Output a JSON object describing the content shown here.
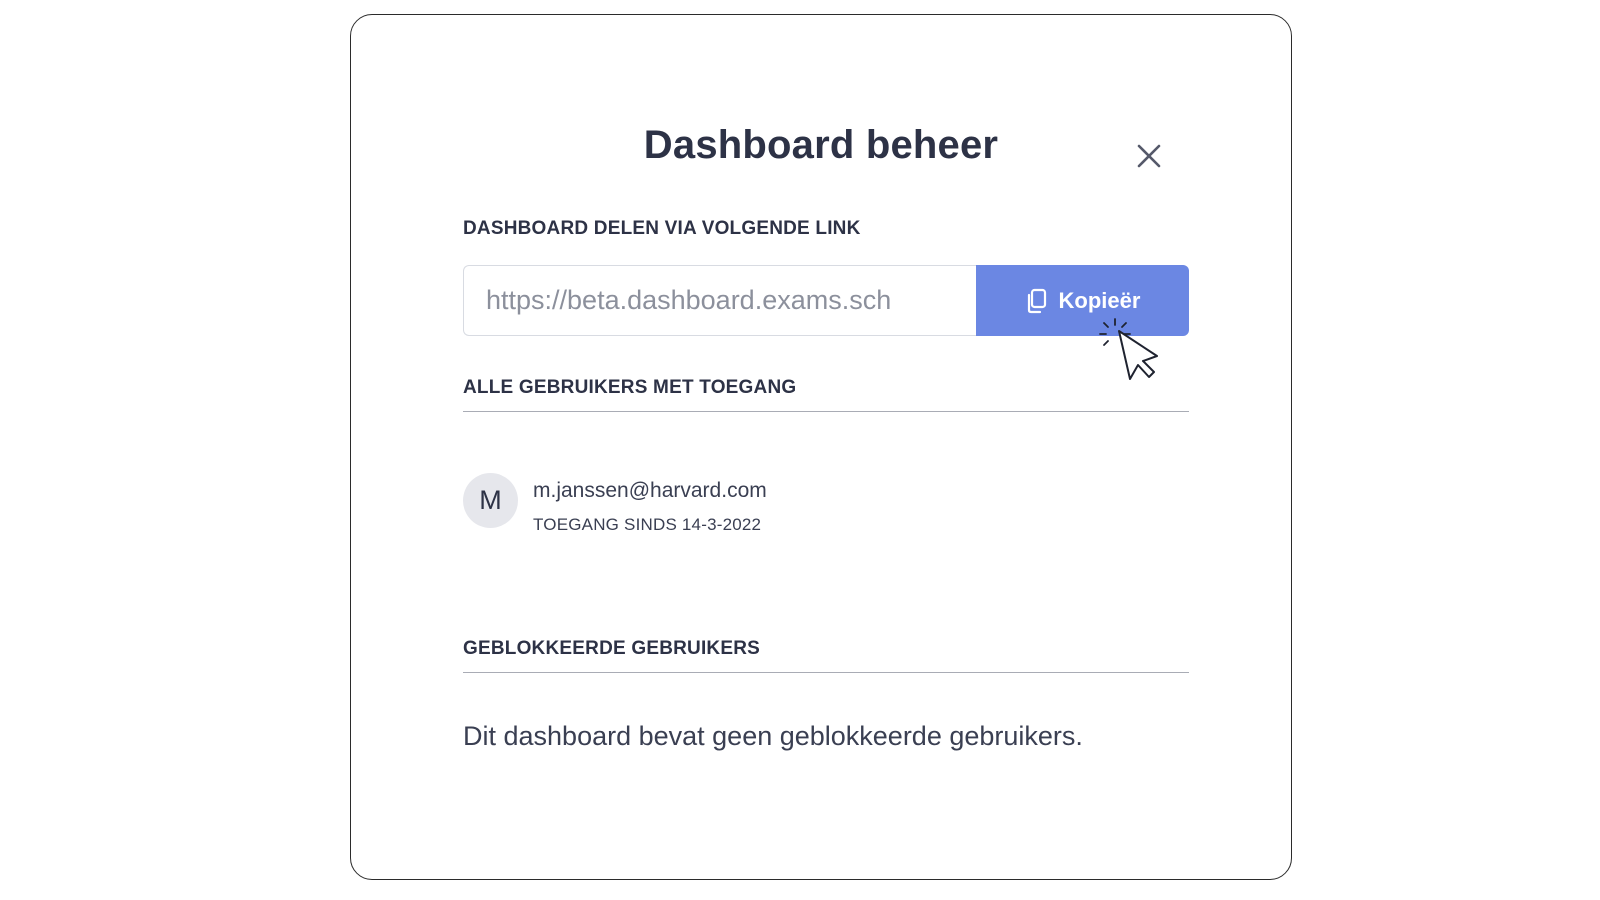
{
  "modal": {
    "title": "Dashboard beheer",
    "close_icon": "close-icon"
  },
  "share": {
    "label": "DASHBOARD DELEN VIA VOLGENDE LINK",
    "link_value": "https://beta.dashboard.exams.sch",
    "copy_label": "Kopieër",
    "copy_icon": "copy-icon",
    "button_color": "#6b87e3"
  },
  "access": {
    "label": "ALLE GEBRUIKERS MET TOEGANG",
    "users": [
      {
        "initial": "M",
        "email": "m.janssen@harvard.com",
        "since": "TOEGANG SINDS 14-3-2022"
      }
    ]
  },
  "blocked": {
    "label": "GEBLOKKEERDE GEBRUIKERS",
    "empty_text": "Dit dashboard bevat geen geblokkeerde gebruikers."
  },
  "cursor": {
    "icon": "pointer-click-icon"
  }
}
